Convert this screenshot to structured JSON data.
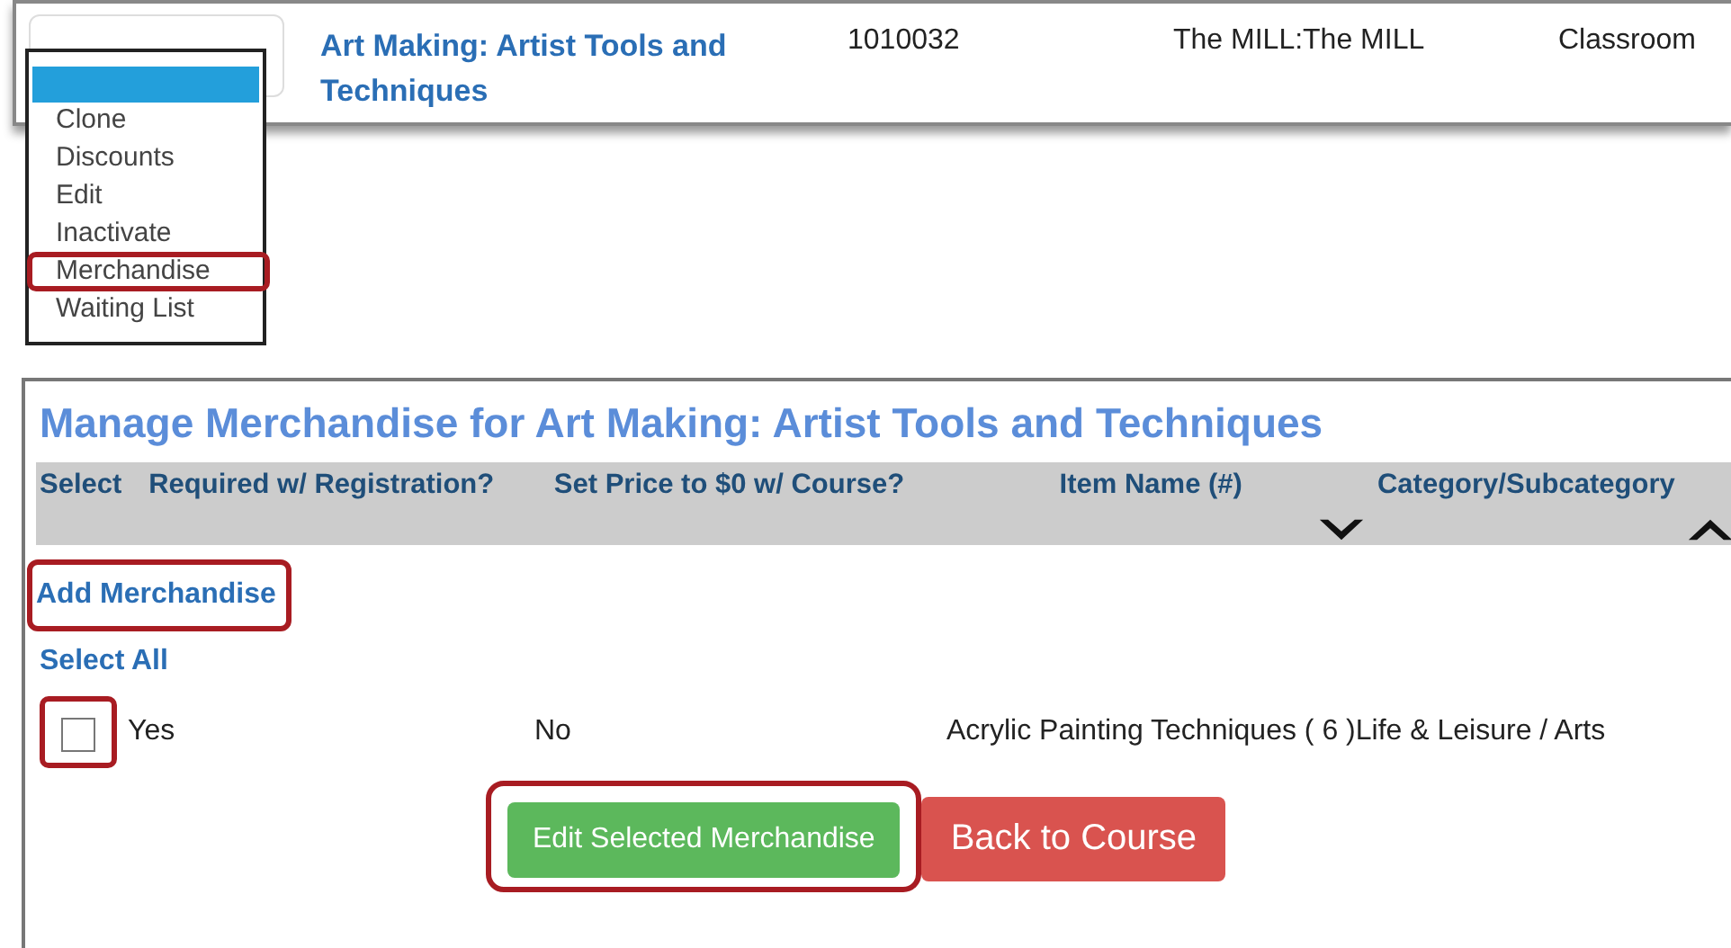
{
  "course_row": {
    "title": "Art Making: Artist Tools and Techniques",
    "number": "1010032",
    "location": "The MILL:The MILL",
    "type": "Classroom"
  },
  "action_menu": {
    "blank_option_highlighted": true,
    "options": [
      {
        "label": "Clone",
        "annotated": false
      },
      {
        "label": "Discounts",
        "annotated": false
      },
      {
        "label": "Edit",
        "annotated": false
      },
      {
        "label": "Inactivate",
        "annotated": false
      },
      {
        "label": "Merchandise",
        "annotated": true
      },
      {
        "label": "Waiting List",
        "annotated": false
      }
    ]
  },
  "merchandise_panel": {
    "title": "Manage Merchandise for Art Making: Artist Tools and Techniques",
    "columns": [
      {
        "label": "Select",
        "sorted_down": false,
        "sorted_up": false
      },
      {
        "label": "Required w/ Registration?",
        "sorted_down": false,
        "sorted_up": false
      },
      {
        "label": "Set Price to $0 w/ Course?",
        "sorted_down": false,
        "sorted_up": false
      },
      {
        "label": "Item Name (#)",
        "sorted_down": true,
        "sorted_up": false
      },
      {
        "label": "Category/Subcategory",
        "sorted_down": false,
        "sorted_up": true
      }
    ],
    "add_link": {
      "label": "Add Merchandise",
      "annotated": true
    },
    "select_all": "Select All",
    "rows": [
      {
        "checked": false,
        "annotated": true,
        "required": "Yes",
        "price_zero": "No",
        "item_name": "Acrylic Painting Techniques ( 6 )",
        "category": "Life & Leisure / Arts"
      }
    ],
    "buttons": [
      {
        "label": "Edit Selected Merchandise",
        "kind": "success",
        "annotated": true
      },
      {
        "label": "Back to Course",
        "kind": "danger",
        "annotated": false
      }
    ]
  }
}
